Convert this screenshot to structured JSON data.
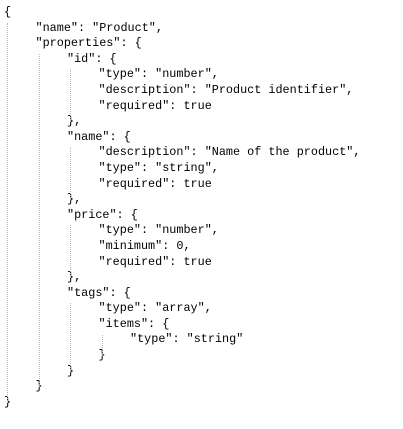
{
  "document": {
    "lines": [
      {
        "indent": 0,
        "text": "{"
      },
      {
        "indent": 1,
        "text": "\"name\": \"Product\","
      },
      {
        "indent": 1,
        "text": "\"properties\": {"
      },
      {
        "indent": 2,
        "text": "\"id\": {"
      },
      {
        "indent": 3,
        "text": "\"type\": \"number\","
      },
      {
        "indent": 3,
        "text": "\"description\": \"Product identifier\","
      },
      {
        "indent": 3,
        "text": "\"required\": true"
      },
      {
        "indent": 2,
        "text": "},"
      },
      {
        "indent": 2,
        "text": "\"name\": {"
      },
      {
        "indent": 3,
        "text": "\"description\": \"Name of the product\","
      },
      {
        "indent": 3,
        "text": "\"type\": \"string\","
      },
      {
        "indent": 3,
        "text": "\"required\": true"
      },
      {
        "indent": 2,
        "text": "},"
      },
      {
        "indent": 2,
        "text": "\"price\": {"
      },
      {
        "indent": 3,
        "text": "\"type\": \"number\","
      },
      {
        "indent": 3,
        "text": "\"minimum\": 0,"
      },
      {
        "indent": 3,
        "text": "\"required\": true"
      },
      {
        "indent": 2,
        "text": "},"
      },
      {
        "indent": 2,
        "text": "\"tags\": {"
      },
      {
        "indent": 3,
        "text": "\"type\": \"array\","
      },
      {
        "indent": 3,
        "text": "\"items\": {"
      },
      {
        "indent": 4,
        "text": "\"type\": \"string\""
      },
      {
        "indent": 3,
        "text": "}"
      },
      {
        "indent": 2,
        "text": "}"
      },
      {
        "indent": 1,
        "text": "}"
      },
      {
        "indent": 0,
        "text": "}"
      }
    ]
  }
}
